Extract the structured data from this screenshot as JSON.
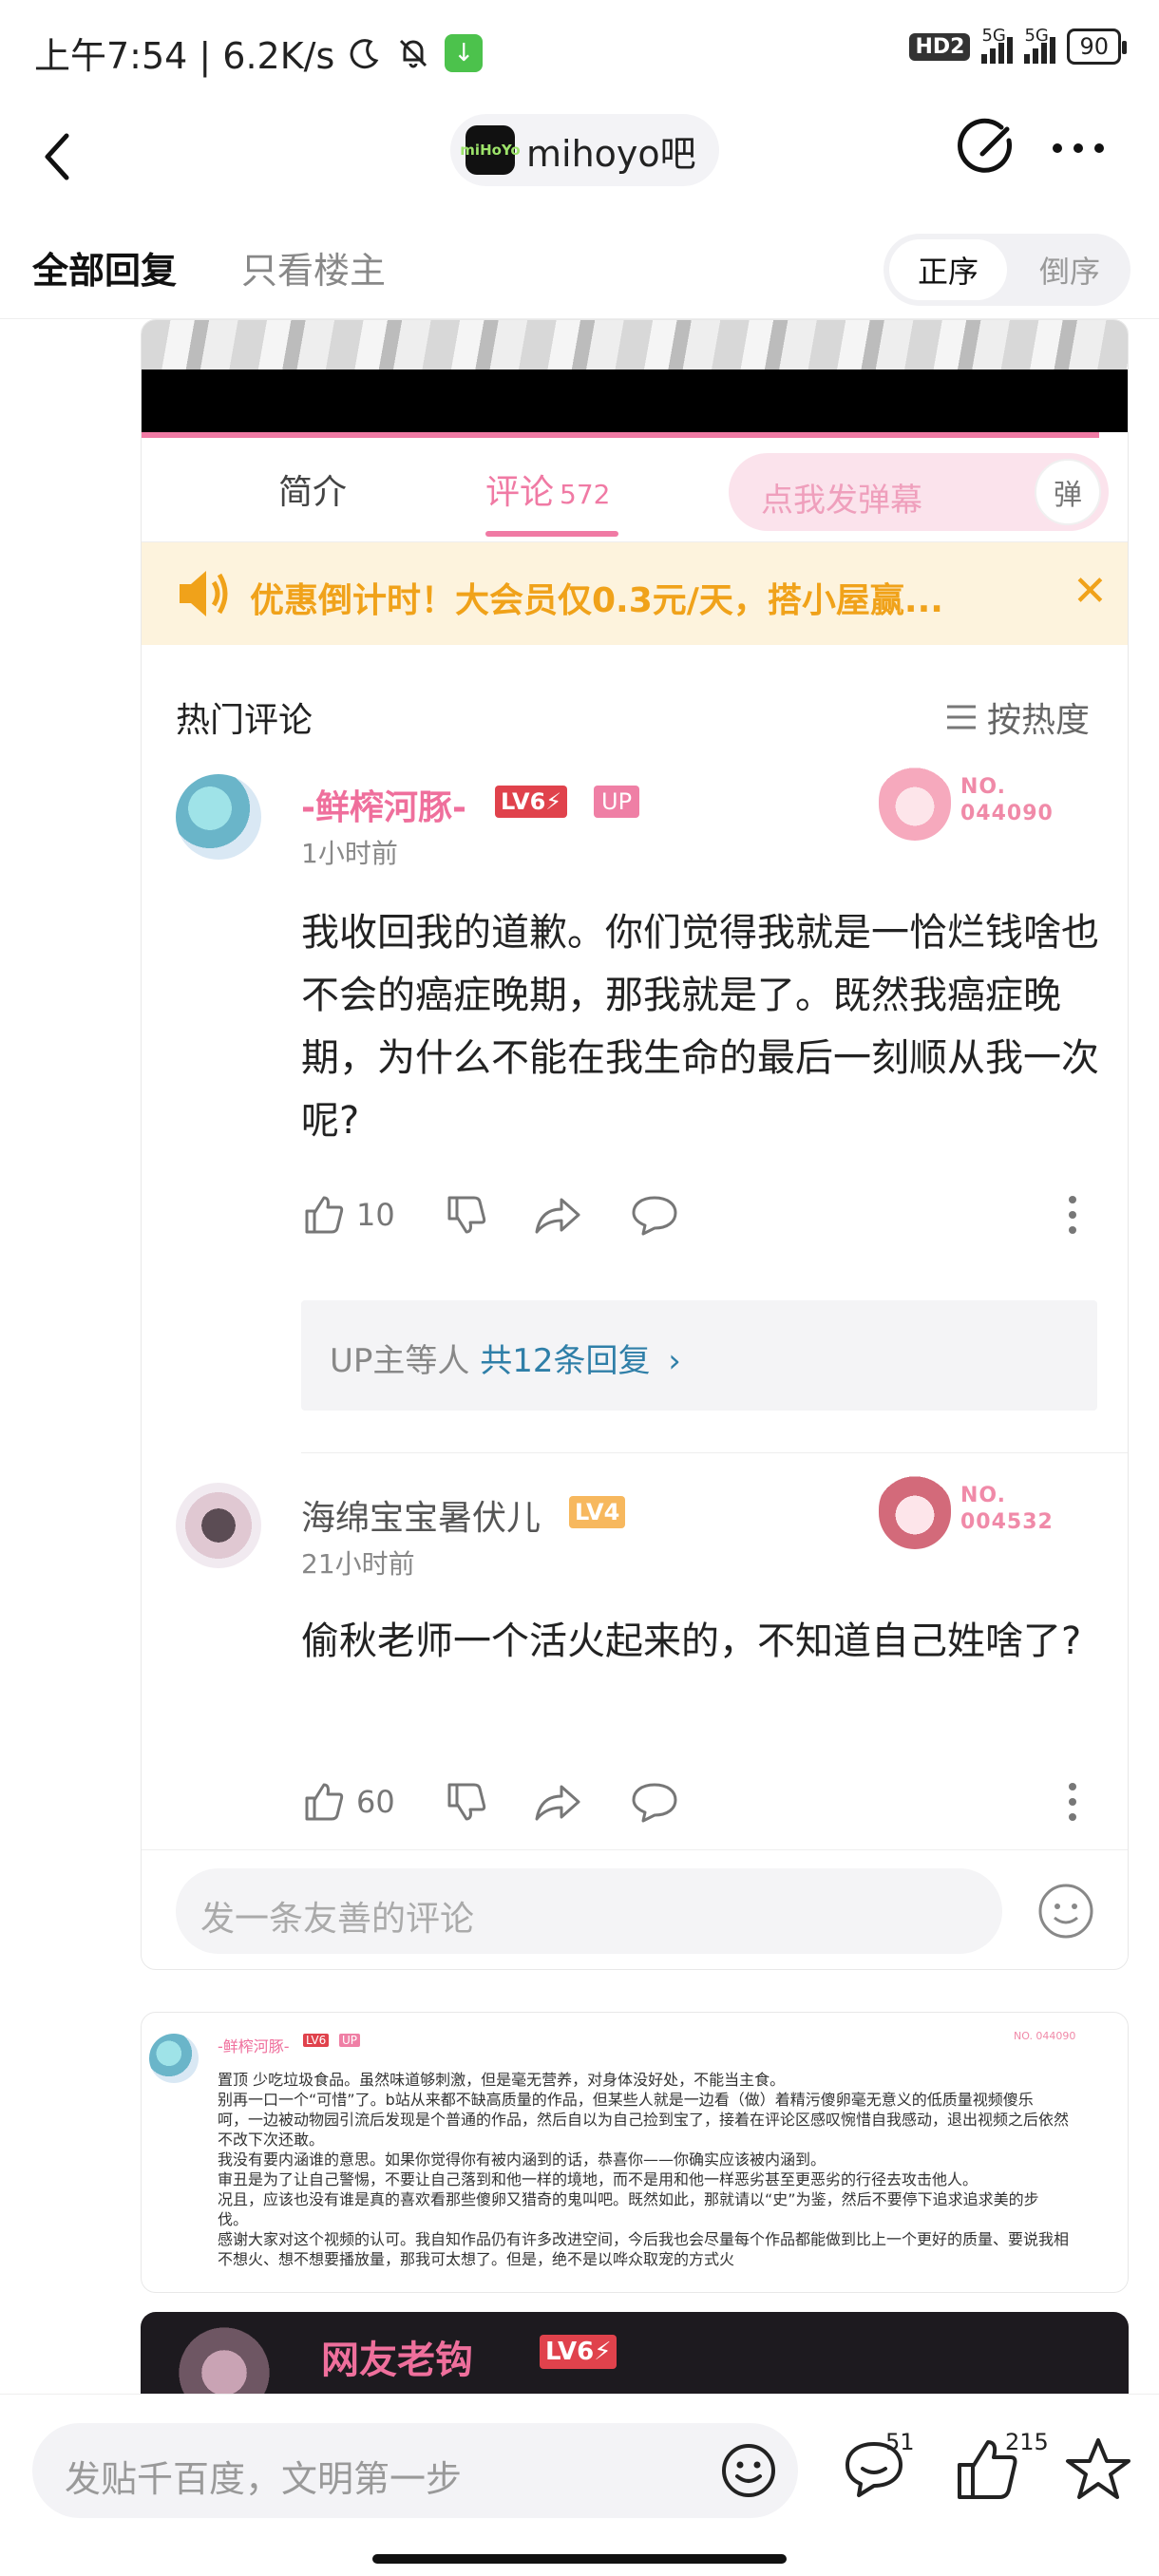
{
  "status_bar": {
    "time": "上午7:54 | 6.2K/s",
    "network_hd": "HD2",
    "signal_1": "5G",
    "signal_2": "5G",
    "battery": "90"
  },
  "nav": {
    "forum_name": "mihoyo吧",
    "forum_logo_text": "miHoYo"
  },
  "tabs": {
    "all_replies": "全部回复",
    "owner_only": "只看楼主",
    "sort_asc": "正序",
    "sort_desc": "倒序"
  },
  "video_page": {
    "tab_intro": "简介",
    "tab_comments": "评论",
    "comment_count": "572",
    "danmaku_placeholder": "点我发弹幕",
    "danmaku_icon": "弹",
    "promo_text": "优惠倒计时！大会员仅0.3元/天，搭小屋赢...",
    "promo_close": "✕",
    "hot_title": "热门评论",
    "hot_sort": "按热度",
    "comments": [
      {
        "username": "-鲜榨河豚-",
        "level": "LV6⚡",
        "up_badge": "UP",
        "time": "1小时前",
        "fan_no": "NO.",
        "fan_number": "044090",
        "text": "我收回我的道歉。你们觉得我就是一恰烂钱啥也不会的癌症晚期，那我就是了。既然我癌症晚期，为什么不能在我生命的最后一刻顺从我一次呢?",
        "likes": "10"
      },
      {
        "username": "海绵宝宝暑伏儿",
        "level": "LV4",
        "time": "21小时前",
        "fan_no": "NO.",
        "fan_number": "004532",
        "text": "偷秋老师一个活火起来的，不知道自己姓啥了?",
        "likes": "60"
      }
    ],
    "reply_prefix": "UP主等人",
    "reply_count": "共12条回复",
    "reply_chevron": "›",
    "comment_input_placeholder": "发一条友善的评论"
  },
  "screenshot_2": {
    "username": "-鲜榨河豚-",
    "level": "LV6",
    "up_badge": "UP",
    "fan": "NO. 044090",
    "lines": [
      "置顶 少吃垃圾食品。虽然味道够刺激，但是毫无营养，对身体没好处，不能当主食。",
      "别再一口一个“可惜”了。b站从来都不缺高质量的作品，但某些人就是一边看（做）着精污傻卵毫无意义的低质量视频傻乐",
      "呵，一边被动物园引流后发现是个普通的作品，然后自以为自己捡到宝了，接着在评论区感叹惋惜自我感动，退出视频之后依然",
      "不改下次还敢。",
      "我没有要内涵谁的意思。如果你觉得你有被内涵到的话，恭喜你——你确实应该被内涵到。",
      "审丑是为了让自己警惕，不要让自己落到和他一样的境地，而不是用和他一样恶劣甚至更恶劣的行径去攻击他人。",
      "况且，应该也没有谁是真的喜欢看那些傻卵又猎奇的鬼叫吧。既然如此，那就请以“史”为鉴，然后不要停下追求追求美的步",
      "伐。",
      "感谢大家对这个视频的认可。我自知作品仍有许多改进空间，今后我也会尽量每个作品都能做到比上一个更好的质量、要说我相",
      "不想火、想不想要播放量，那我可太想了。但是，绝不是以哗众取宠的方式火"
    ]
  },
  "screenshot_3": {
    "username": "网友老钩",
    "level": "LV6⚡"
  },
  "bottom_bar": {
    "input_placeholder": "发贴千百度，文明第一步",
    "comment_count": "51",
    "like_count": "215"
  },
  "colors": {
    "bili_pink": "#f07aa4",
    "promo_orange": "#f0a21a",
    "reply_blue": "#2f7fa8"
  }
}
